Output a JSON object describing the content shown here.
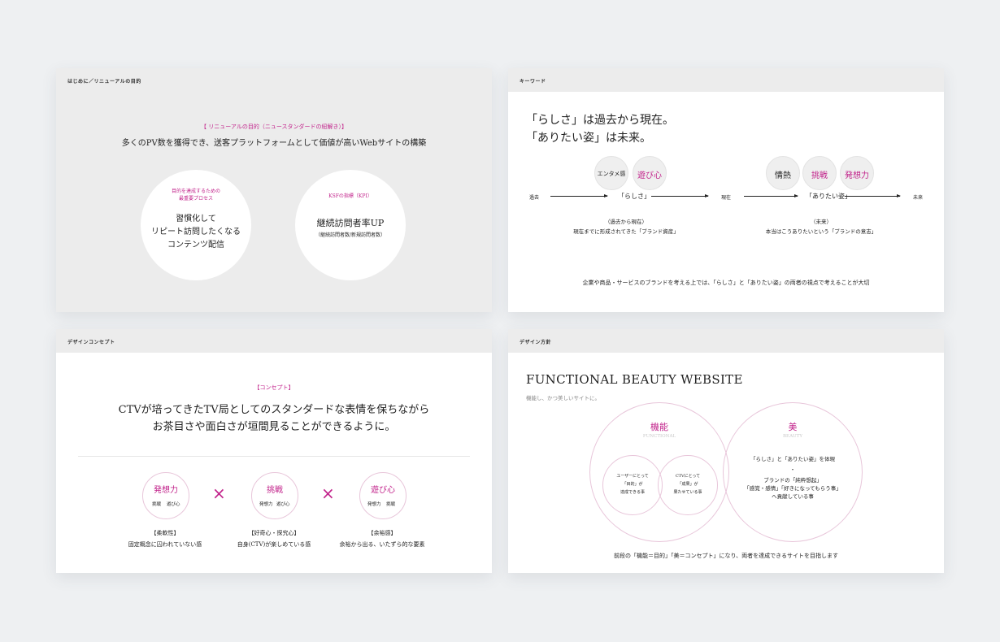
{
  "panel1": {
    "header": "はじめに／リニューアルの目的",
    "tag": "【 リニューアルの目的（ニュースタンダードの紐解き）】",
    "lead": "多くのPV数を獲得でき、送客プラットフォームとして価値が高いWebサイトの構築",
    "circle_left": {
      "label1": "目的を達成するための",
      "label2": "最重要プロセス",
      "line1": "習慣化して",
      "line2": "リピート訪問したくなる",
      "line3": "コンテンツ配信"
    },
    "circle_right": {
      "label": "KSFの指標（KPI）",
      "main": "継続訪問者率UP",
      "sub": "（継続訪問者数/新規訪問者数）"
    }
  },
  "panel2": {
    "header": "キーワード",
    "title1": "「らしさ」は過去から現在。",
    "title2": "「ありたい姿」は未来。",
    "past_bubbles": [
      "エンタメ感",
      "遊び心"
    ],
    "future_bubbles": [
      "情熱",
      "挑戦",
      "発想力"
    ],
    "timeline": {
      "past": "過去",
      "rashisa": "「らしさ」",
      "present": "現在",
      "aritai": "「ありたい姿」",
      "future": "未来"
    },
    "note_left1": "（過去から現在）",
    "note_left2": "現在までに形成されてきた「ブランド資産」",
    "note_right1": "（未来）",
    "note_right2": "本当はこうありたいという「ブランドの意志」",
    "footer": "企業や商品・サービスのブランドを考える上では、「らしさ」と「ありたい姿」の両者の視点で考えることが大切"
  },
  "panel3": {
    "header": "デザインコンセプト",
    "tag": "【コンセプト】",
    "concept1": "CTVが培ってきたTV局としてのスタンダードな表情を保ちながら",
    "concept2": "お茶目さや面白さが垣間見ることができるように。",
    "cross": "×",
    "items": [
      {
        "title": "発想力",
        "a": "挑戦",
        "b": "遊び心",
        "label": "【柔軟性】",
        "desc": "固定概念に囚われていない感"
      },
      {
        "title": "挑戦",
        "a": "発想力",
        "b": "遊び心",
        "label": "【好奇心・探究心】",
        "desc": "自身(CTV)が楽しめている感"
      },
      {
        "title": "遊び心",
        "a": "発想力",
        "b": "挑戦",
        "label": "【余裕感】",
        "desc": "余裕から出る、いたずら的な要素"
      }
    ]
  },
  "panel4": {
    "header": "デザイン方針",
    "title": "FUNCTIONAL BEAUTY WEBSITE",
    "subtitle": "機能し、かつ美しいサイトに。",
    "left_title": "機能",
    "left_en": "FUNCTIONAL",
    "right_title": "美",
    "right_en": "BEAUTY",
    "inner_left": {
      "l1": "ユーザーにとって",
      "l2": "「目的」が",
      "l3": "達成できる事"
    },
    "inner_right": {
      "l1": "CTVにとって",
      "l2": "「成果」が",
      "l3": "果たせている事"
    },
    "beauty_l1": "「らしさ」と「ありたい姿」を体現",
    "beauty_dot": "・",
    "beauty_l2": "ブランドの「純粋想起」",
    "beauty_l3": "「感覚・感情」「好きになってもらう事」",
    "beauty_l4": "へ貢献している事",
    "footer": "前段の「機能＝目的」「美＝コンセプト」になり、両者を達成できるサイトを目指します"
  },
  "colors": {
    "accent": "#c2238b",
    "panel_gray": "#ececec",
    "background": "#eef0f2"
  }
}
